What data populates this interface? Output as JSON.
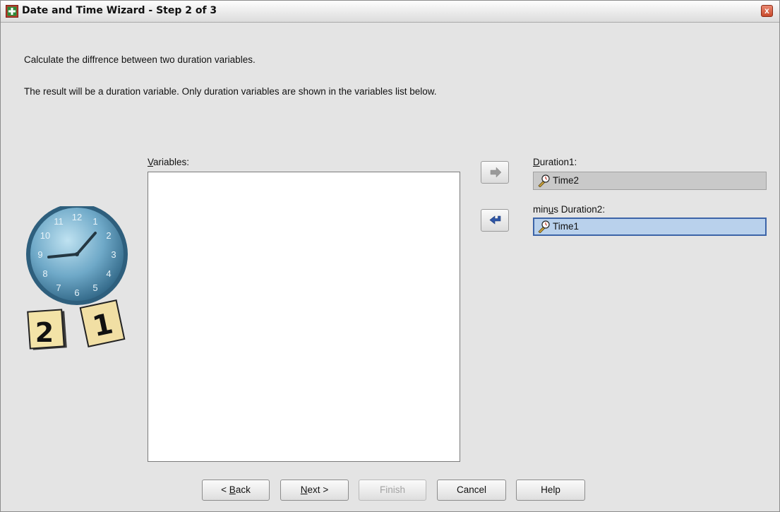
{
  "window": {
    "title": "Date and Time Wizard - Step 2 of 3",
    "close_glyph": "x"
  },
  "description": {
    "line1": "Calculate the diffrence between two duration variables.",
    "line2": "The result will be a duration variable. Only duration variables are shown in the variables list below."
  },
  "variables_list": {
    "label_mnemonic": "V",
    "label_rest": "ariables:",
    "items": []
  },
  "duration1": {
    "label_mnemonic": "D",
    "label_rest": "uration1:",
    "value": "Time2",
    "icon": "duration-variable-icon"
  },
  "duration2": {
    "label_pre": "min",
    "label_mnemonic": "u",
    "label_rest": "s Duration2:",
    "value": "Time1",
    "icon": "duration-variable-icon",
    "selected": true
  },
  "arrow_buttons": {
    "move_to_duration1": {
      "icon": "right-arrow-icon",
      "enabled": false
    },
    "move_to_duration2": {
      "icon": "left-arrow-icon",
      "enabled": true
    }
  },
  "wizard_art": {
    "clock_numbers": [
      "12",
      "1",
      "2",
      "3",
      "4",
      "5",
      "6",
      "7",
      "8",
      "9",
      "10",
      "11"
    ],
    "calendar_left": "2",
    "calendar_right": "1"
  },
  "footer": {
    "back": {
      "prefix": "< ",
      "mnemonic": "B",
      "rest": "ack"
    },
    "next": {
      "mnemonic": "N",
      "rest": "ext",
      "suffix": " >"
    },
    "finish": {
      "label": "Finish",
      "enabled": false
    },
    "cancel": {
      "label": "Cancel"
    },
    "help": {
      "label": "Help"
    }
  },
  "colors": {
    "dialog_bg": "#e4e4e4",
    "selected_field_bg": "#b9d1ec",
    "selected_field_border": "#3c64a8",
    "arrow_active": "#2f56a6",
    "arrow_disabled": "#9a9a9a"
  }
}
